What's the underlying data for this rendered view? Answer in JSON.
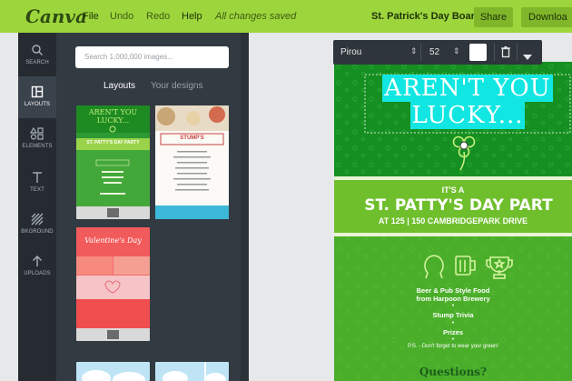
{
  "header": {
    "logo": "Canva",
    "menu": [
      "File",
      "Undo",
      "Redo",
      "Help"
    ],
    "status": "All changes saved",
    "design_title": "St. Patrick's Day Board",
    "share_label": "Share",
    "download_label": "Downloa"
  },
  "sidebar": {
    "items": [
      {
        "label": "SEARCH",
        "icon": "search-icon"
      },
      {
        "label": "LAYOUTS",
        "icon": "layouts-icon"
      },
      {
        "label": "ELEMENTS",
        "icon": "elements-icon"
      },
      {
        "label": "TEXT",
        "icon": "text-icon"
      },
      {
        "label": "BKGROUND",
        "icon": "background-icon"
      },
      {
        "label": "UPLOADS",
        "icon": "upload-icon"
      }
    ],
    "active": "LAYOUTS"
  },
  "panel": {
    "search_placeholder": "Search 1,000,000 images...",
    "tabs": [
      "Layouts",
      "Your designs"
    ],
    "active_tab": "Layouts",
    "thumbs": [
      {
        "heading": "AREN'T YOU LUCKY...",
        "sub": "ST. PATTY'S DAY PARTY"
      },
      {
        "heading": "STUMP'S"
      },
      {
        "heading": "Valentine's Day"
      }
    ]
  },
  "toolbar": {
    "font": "Pirou",
    "size": "52",
    "color": "#ffffff"
  },
  "design": {
    "headline": [
      "AREN'T YOU",
      "LUCKY..."
    ],
    "its_a": "IT'S A",
    "party": "ST. PATTY'S DAY PART",
    "address": "AT 125 | 150 CAMBRIDGEPARK DRIVE",
    "items": [
      "Beer & Pub Style Food",
      "from Harpoon Brewery",
      "Stump Trivia",
      "Prizes"
    ],
    "bullets": [
      "•",
      "•",
      "•"
    ],
    "note": "P.S. - Don't forget to wear your green!",
    "questions": "Questions?"
  },
  "colors": {
    "topbar": "#9dd63c",
    "dark_green": "#1e8a22",
    "mid_green": "#78c13a",
    "cyan_highlight": "#11e6e2"
  }
}
